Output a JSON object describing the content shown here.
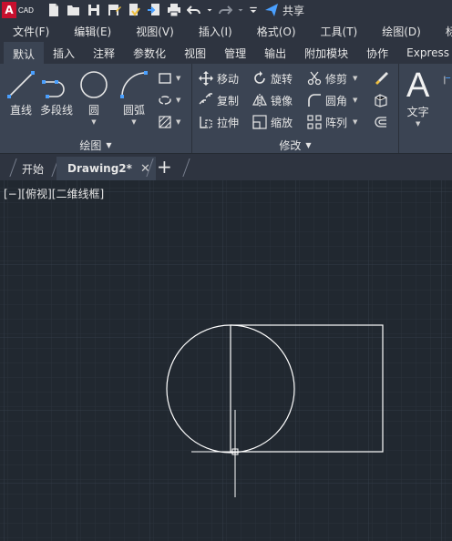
{
  "app": {
    "logo_letter": "A",
    "logo_text": "CAD",
    "share_label": "共享",
    "accent_color": "#c8102e"
  },
  "menu": [
    {
      "label": "文件(F)"
    },
    {
      "label": "编辑(E)"
    },
    {
      "label": "视图(V)"
    },
    {
      "label": "插入(I)"
    },
    {
      "label": "格式(O)"
    },
    {
      "label": "工具(T)"
    },
    {
      "label": "绘图(D)"
    },
    {
      "label": "标注("
    }
  ],
  "ribbon_tabs": [
    {
      "label": "默认"
    },
    {
      "label": "插入"
    },
    {
      "label": "注释"
    },
    {
      "label": "参数化"
    },
    {
      "label": "视图"
    },
    {
      "label": "管理"
    },
    {
      "label": "输出"
    },
    {
      "label": "附加模块"
    },
    {
      "label": "协作"
    },
    {
      "label": "Express T"
    }
  ],
  "draw_panel": {
    "title": "绘图",
    "tools": [
      {
        "label": "直线",
        "icon": "line-icon"
      },
      {
        "label": "多段线",
        "icon": "polyline-icon"
      },
      {
        "label": "圆",
        "icon": "circle-icon"
      },
      {
        "label": "圆弧",
        "icon": "arc-icon"
      }
    ]
  },
  "modify_panel": {
    "title": "修改",
    "tools": [
      {
        "label": "移动",
        "icon": "move-icon"
      },
      {
        "label": "旋转",
        "icon": "rotate-icon"
      },
      {
        "label": "修剪",
        "icon": "trim-icon"
      },
      {
        "label": "复制",
        "icon": "copy-icon"
      },
      {
        "label": "镜像",
        "icon": "mirror-icon"
      },
      {
        "label": "圆角",
        "icon": "fillet-icon"
      },
      {
        "label": "拉伸",
        "icon": "stretch-icon"
      },
      {
        "label": "缩放",
        "icon": "scale-icon"
      },
      {
        "label": "阵列",
        "icon": "array-icon"
      }
    ]
  },
  "annotation_panel": {
    "tools": [
      {
        "label": "文字",
        "icon": "text-icon",
        "glyph": "A"
      }
    ]
  },
  "doc_tabs": [
    {
      "label": "开始"
    },
    {
      "label": "Drawing2*"
    }
  ],
  "viewport": {
    "label": "[−][俯视][二维线框]"
  }
}
